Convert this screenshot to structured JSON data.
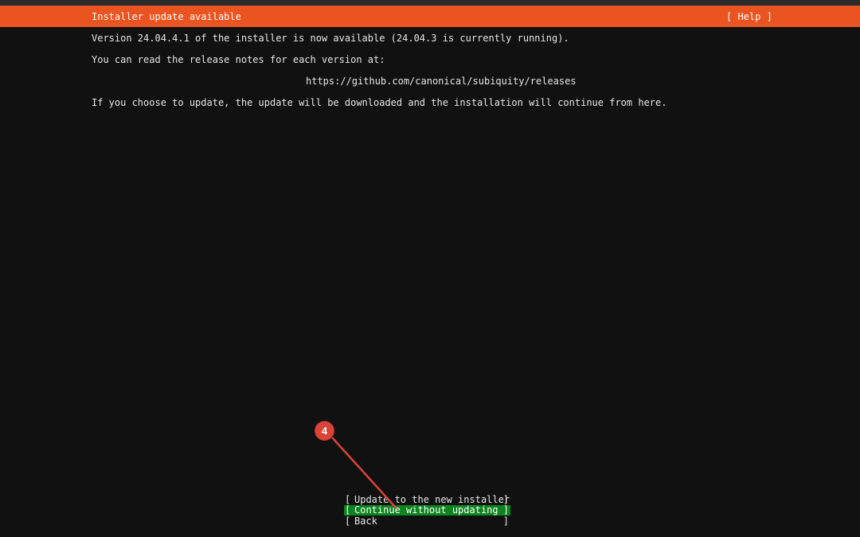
{
  "header": {
    "title": "Installer update available",
    "help_label": "[ Help ]"
  },
  "body": {
    "line1": "Version 24.04.4.1 of the installer is now available (24.04.3 is currently running).",
    "line2": "You can read the release notes for each version at:",
    "url": "https://github.com/canonical/subiquity/releases",
    "line3": "If you choose to update, the update will be downloaded and the installation will continue from here."
  },
  "buttons": [
    {
      "label": "Update to the new installer",
      "selected": false
    },
    {
      "label": "Continue without updating",
      "selected": true
    },
    {
      "label": "Back",
      "selected": false
    }
  ],
  "annotation": {
    "step_number": "4",
    "color": "#d9443a"
  },
  "colors": {
    "header_bg": "#e95420",
    "selected_bg": "#0e8420",
    "background": "#111111"
  }
}
